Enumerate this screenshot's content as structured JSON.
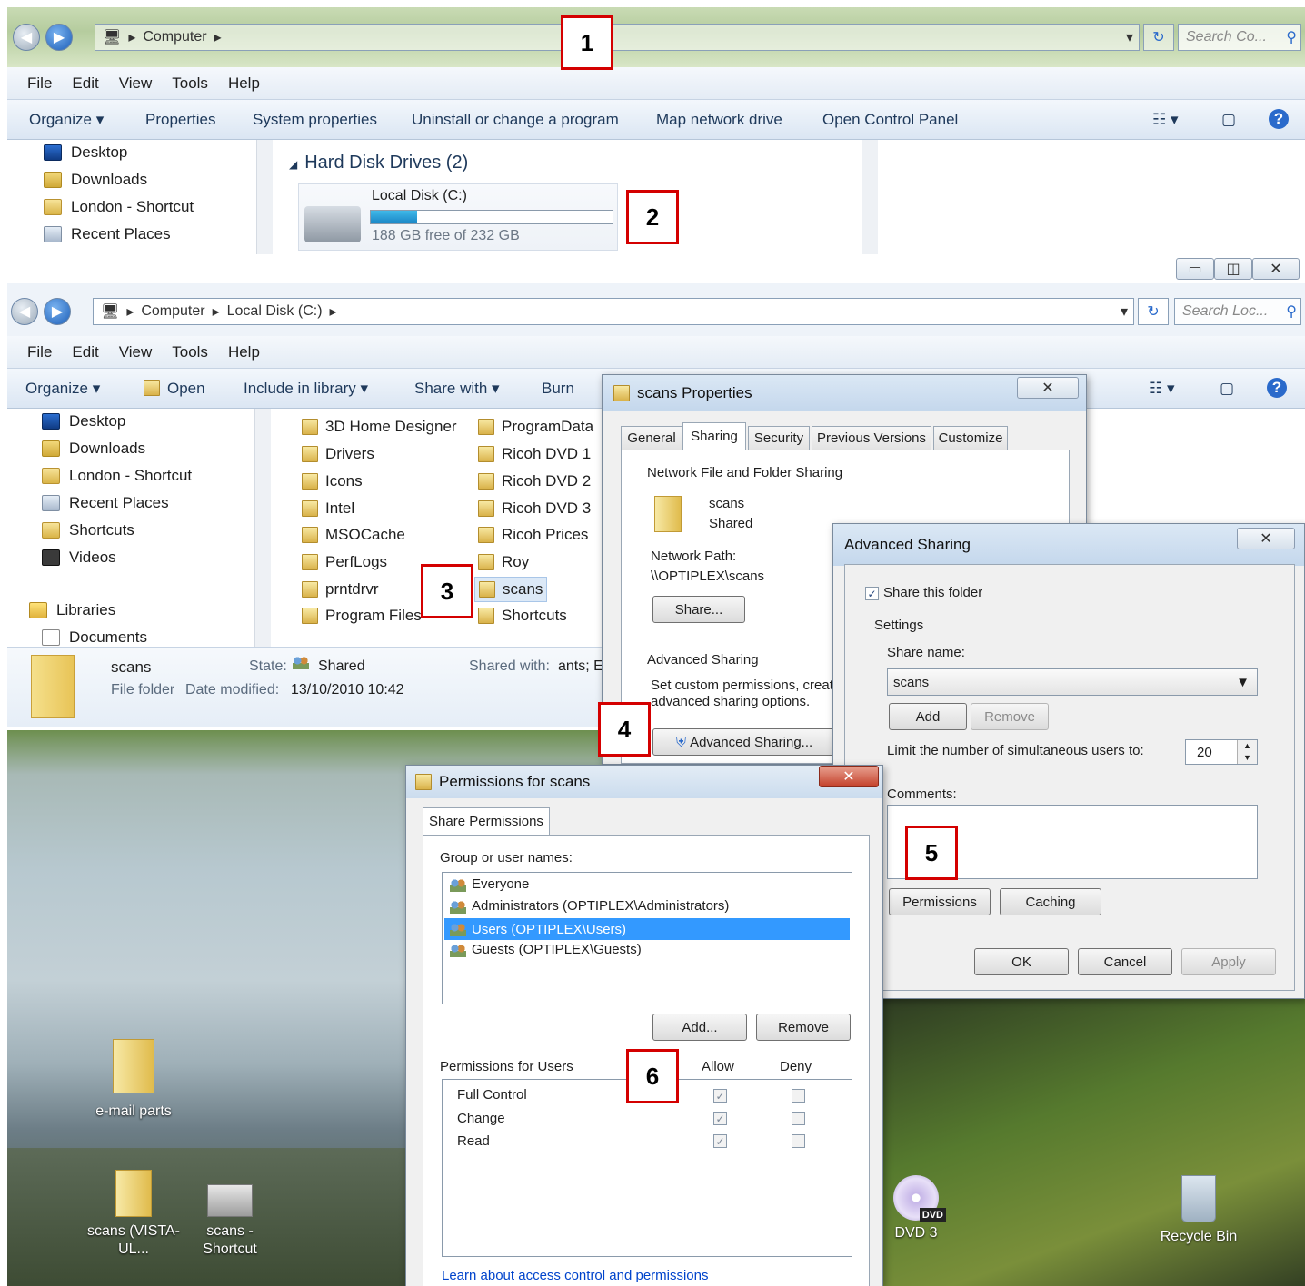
{
  "window1": {
    "breadcrumb": [
      "Computer"
    ],
    "search_placeholder": "Search Co...",
    "menu": [
      "File",
      "Edit",
      "View",
      "Tools",
      "Help"
    ],
    "commands": [
      "Organize ▾",
      "Properties",
      "System properties",
      "Uninstall or change a program",
      "Map network drive",
      "Open Control Panel"
    ],
    "nav_items": [
      "Desktop",
      "Downloads",
      "London - Shortcut",
      "Recent Places"
    ],
    "group_title": "Hard Disk Drives (2)",
    "drive": {
      "name": "Local Disk (C:)",
      "free_text": "188 GB free of 232 GB",
      "used_fraction": 0.19
    }
  },
  "window2": {
    "breadcrumb": [
      "Computer",
      "Local Disk (C:)"
    ],
    "search_placeholder": "Search Loc...",
    "menu": [
      "File",
      "Edit",
      "View",
      "Tools",
      "Help"
    ],
    "commands": [
      "Organize ▾",
      "Open",
      "Include in library ▾",
      "Share with ▾",
      "Burn"
    ],
    "nav_items": [
      "Desktop",
      "Downloads",
      "London - Shortcut",
      "Recent Places",
      "Shortcuts",
      "Videos",
      "Libraries",
      "Documents"
    ],
    "folders_col1": [
      "3D Home Designer",
      "Drivers",
      "Icons",
      "Intel",
      "MSOCache",
      "PerfLogs",
      "prntdrvr",
      "Program Files"
    ],
    "folders_col2": [
      "ProgramData",
      "Ricoh DVD 1",
      "Ricoh DVD 2",
      "Ricoh DVD 3",
      "Ricoh Prices",
      "Roy",
      "scans",
      "Shortcuts"
    ],
    "details": {
      "name": "scans",
      "state_label": "State:",
      "state_value": "Shared",
      "shared_with_label": "Shared with:",
      "shared_with_value": "ants; E",
      "type": "File folder",
      "date_label": "Date modified:",
      "date_value": "13/10/2010 10:42"
    }
  },
  "desktop": {
    "icons": [
      "e-mail parts",
      "scans (VISTA-UL...",
      "scans - Shortcut",
      "DVD 3",
      "Recycle Bin"
    ],
    "dvd_badge": "DVD"
  },
  "scans_properties": {
    "title": "scans Properties",
    "tabs": [
      "General",
      "Sharing",
      "Security",
      "Previous Versions",
      "Customize"
    ],
    "section1": "Network File and Folder Sharing",
    "folder_name": "scans",
    "folder_state": "Shared",
    "network_path_label": "Network Path:",
    "network_path": "\\\\OPTIPLEX\\scans",
    "share_button": "Share...",
    "section2": "Advanced Sharing",
    "adv_desc_1": "Set custom permissions, create",
    "adv_desc_2": "advanced sharing options.",
    "adv_button": "Advanced Sharing..."
  },
  "advanced_sharing": {
    "title": "Advanced Sharing",
    "share_checkbox": "Share this folder",
    "settings_label": "Settings",
    "share_name_label": "Share name:",
    "share_name_value": "scans",
    "add": "Add",
    "remove": "Remove",
    "limit_label": "Limit the number of simultaneous users to:",
    "limit_value": "20",
    "comments_label": "Comments:",
    "permissions": "Permissions",
    "caching": "Caching",
    "ok": "OK",
    "cancel": "Cancel",
    "apply": "Apply"
  },
  "permissions_dialog": {
    "title": "Permissions for scans",
    "tab": "Share Permissions",
    "group_label": "Group or user names:",
    "users": [
      "Everyone",
      "Administrators (OPTIPLEX\\Administrators)",
      "Users (OPTIPLEX\\Users)",
      "Guests (OPTIPLEX\\Guests)"
    ],
    "add": "Add...",
    "remove": "Remove",
    "perm_label": "Permissions for Users",
    "allow": "Allow",
    "deny": "Deny",
    "perms": [
      "Full Control",
      "Change",
      "Read"
    ],
    "link": "Learn about access control and permissions"
  },
  "badges": [
    "1",
    "2",
    "3",
    "4",
    "5",
    "6"
  ],
  "colors": {
    "selection": "#3399ff",
    "badge_border": "#d40000",
    "link": "#0044cc",
    "title_tint": "#c4d7ec"
  }
}
